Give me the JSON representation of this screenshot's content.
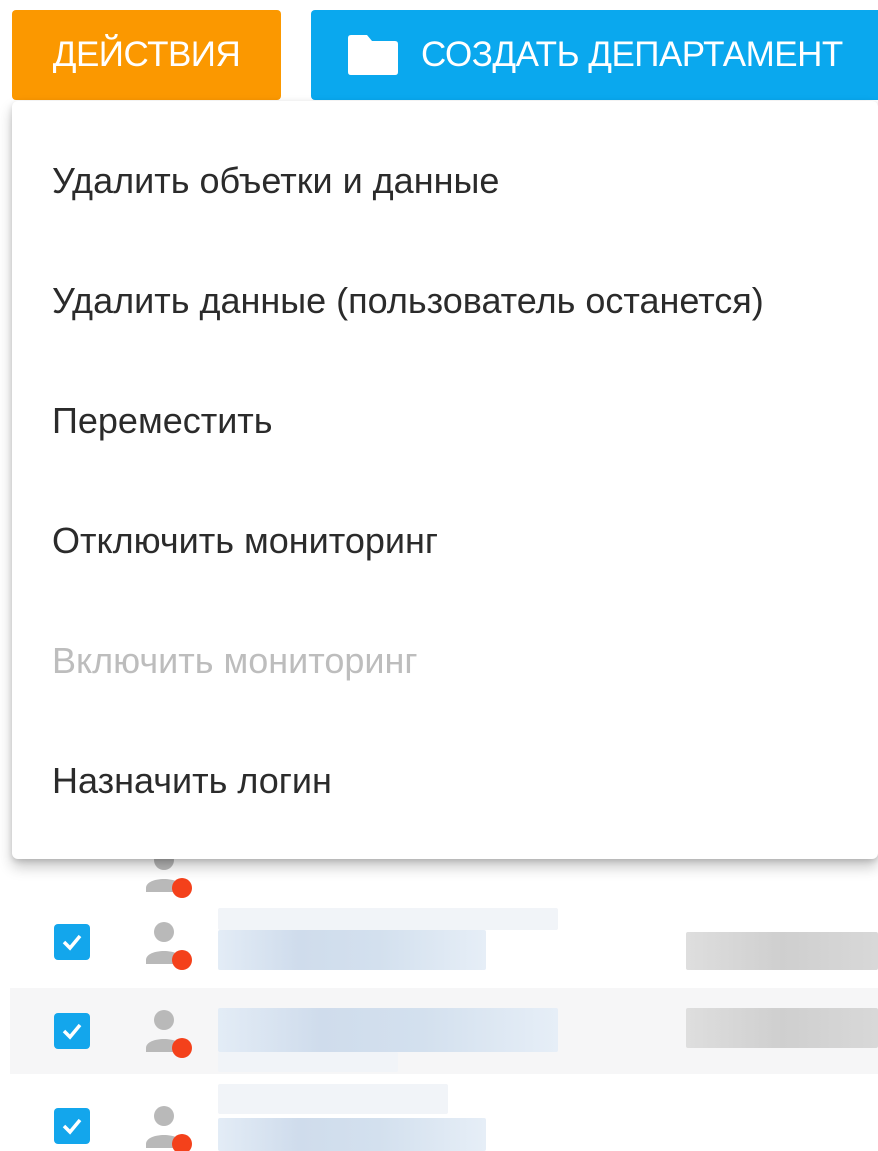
{
  "toolbar": {
    "actions_label": "ДЕЙСТВИЯ",
    "create_department_label": "СОЗДАТЬ ДЕПАРТАМЕНТ",
    "create_icon": "folder-icon"
  },
  "colors": {
    "actions_button": "#fb9800",
    "create_button": "#0aa8ee",
    "checkbox": "#13a6ec",
    "status_dot": "#f4411b"
  },
  "menu": {
    "items": [
      {
        "label": "Удалить объетки и данные",
        "disabled": false
      },
      {
        "label": "Удалить данные (пользователь останется)",
        "disabled": false
      },
      {
        "label": "Переместить",
        "disabled": false
      },
      {
        "label": "Отключить мониторинг",
        "disabled": false
      },
      {
        "label": "Включить мониторинг",
        "disabled": true
      },
      {
        "label": "Назначить логин",
        "disabled": false
      }
    ]
  },
  "rows": [
    {
      "checked": true,
      "icon": "user-offline-icon"
    },
    {
      "checked": true,
      "icon": "user-offline-icon"
    },
    {
      "checked": true,
      "icon": "user-offline-icon"
    }
  ]
}
